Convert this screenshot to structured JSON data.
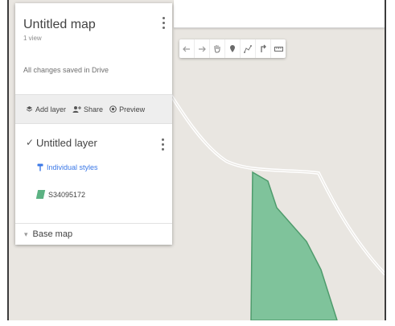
{
  "map_panel": {
    "title": "Untitled map",
    "views": "1 view",
    "save_status": "All changes saved in Drive",
    "actions": [
      {
        "icon": "add-layer-icon",
        "label": "Add layer"
      },
      {
        "icon": "share-icon",
        "label": "Share"
      },
      {
        "icon": "preview-icon",
        "label": "Preview"
      }
    ],
    "layer": {
      "checked": true,
      "name": "Untitled layer",
      "style_label": "Individual styles",
      "feature_name": "S34095172"
    },
    "basemap_label": "Base map"
  },
  "toolbar": {
    "tools": [
      "undo-icon",
      "redo-icon",
      "pan-hand-icon",
      "add-marker-icon",
      "draw-line-icon",
      "directions-icon",
      "measure-ruler-icon"
    ]
  },
  "colors": {
    "map_background": "#e9e6e1",
    "polygon_fill": "#7fc39b",
    "polygon_stroke": "#4e9b6c",
    "road": "#ffffff",
    "link": "#3b78e7"
  }
}
